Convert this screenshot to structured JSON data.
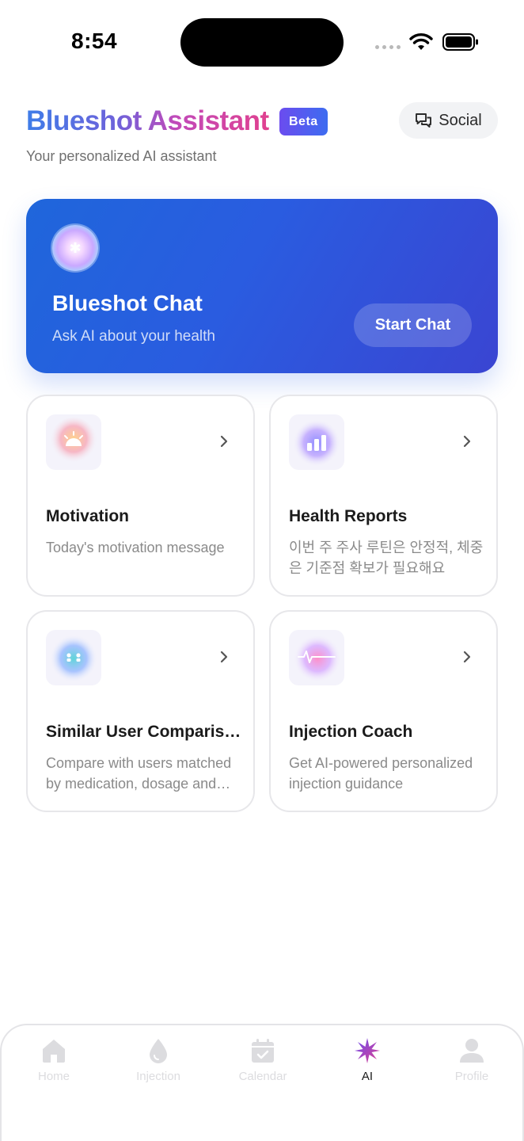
{
  "status_bar": {
    "time": "8:54"
  },
  "header": {
    "title": "Blueshot Assistant",
    "beta": "Beta",
    "social_label": "Social",
    "subtitle": "Your personalized AI assistant"
  },
  "chat_card": {
    "title": "Blueshot Chat",
    "subtitle": "Ask AI about your health",
    "button": "Start Chat"
  },
  "features": [
    {
      "title": "Motivation",
      "desc": "Today's motivation message",
      "icon": "sunrise-icon"
    },
    {
      "title": "Health Reports",
      "desc": "이번 주 주사 루틴은 안정적, 체중은 기준점 확보가 필요해요",
      "icon": "bar-chart-icon"
    },
    {
      "title": "Similar User Comparison",
      "desc": "Compare with users matched by medication, dosage and goals",
      "icon": "users-icon"
    },
    {
      "title": "Injection Coach",
      "desc": "Get AI-powered personalized injection guidance",
      "icon": "pulse-icon"
    }
  ],
  "tabs": [
    {
      "label": "Home",
      "icon": "home-icon"
    },
    {
      "label": "Injection",
      "icon": "drop-icon"
    },
    {
      "label": "Calendar",
      "icon": "calendar-icon"
    },
    {
      "label": "AI",
      "icon": "sparkle-icon",
      "active": true
    },
    {
      "label": "Profile",
      "icon": "profile-icon"
    }
  ],
  "colors": {
    "accent_blue": "#2a5ce0",
    "accent_magenta": "#e0418f",
    "beta_purple": "#6b4cef"
  }
}
